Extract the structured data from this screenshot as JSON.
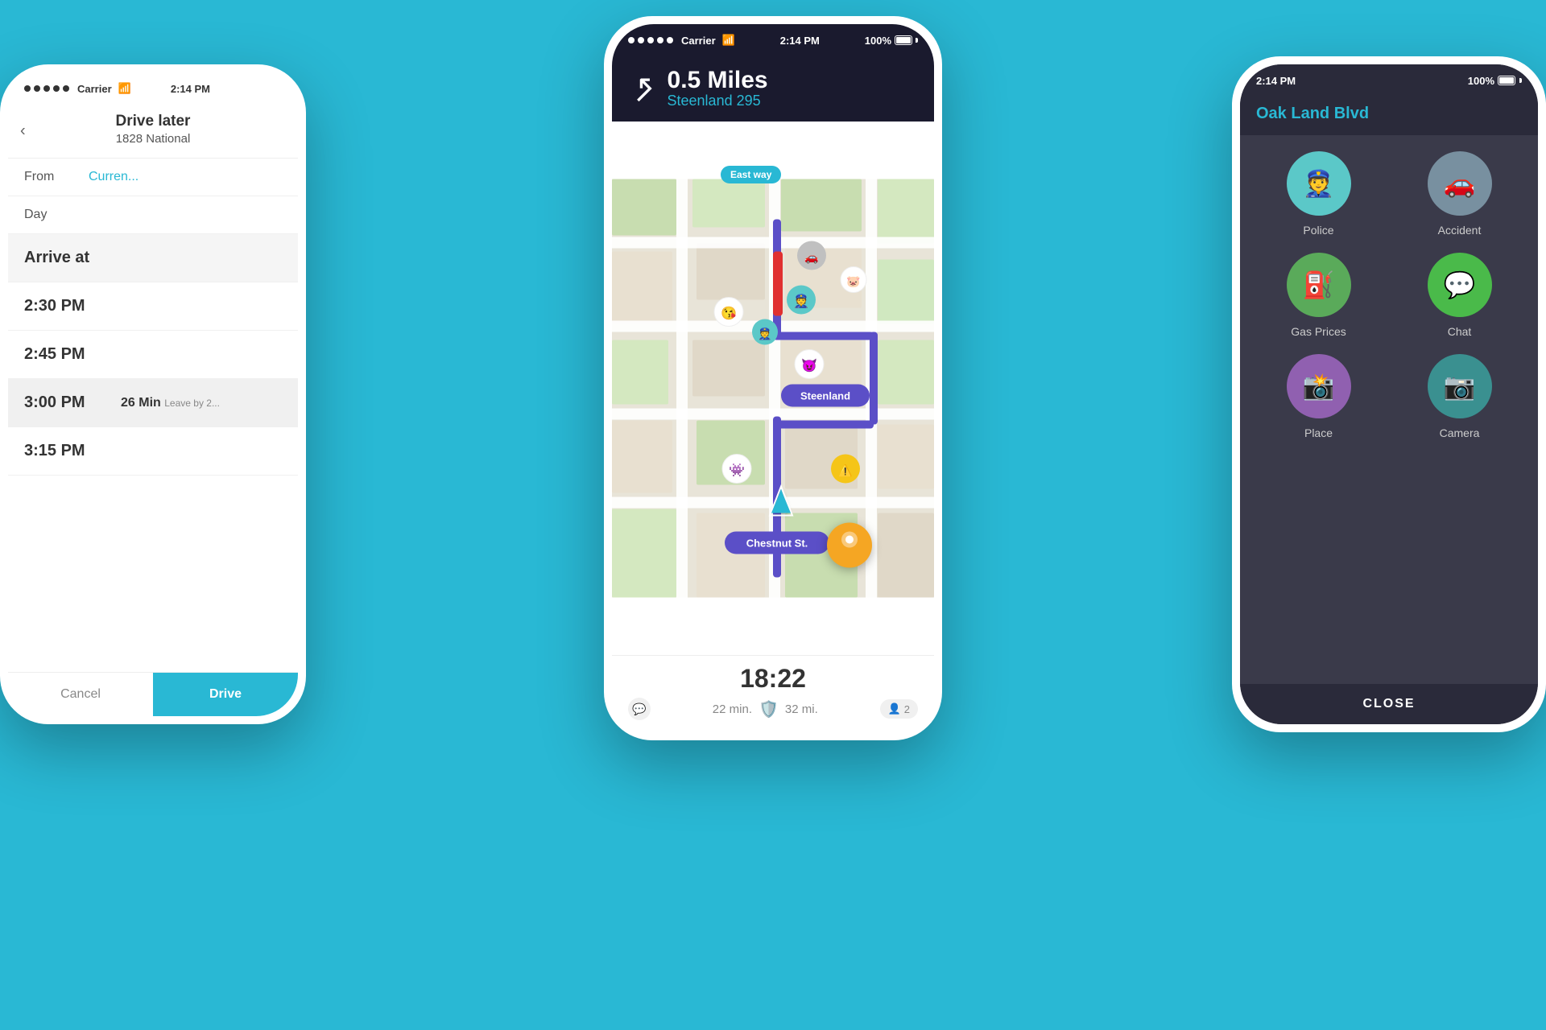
{
  "background_color": "#29b8d4",
  "phones": {
    "left": {
      "status_bar": {
        "carrier": "Carrier",
        "wifi": true,
        "time": "2:14 PM"
      },
      "header": {
        "back_label": "‹",
        "title": "Drive later",
        "subtitle": "1828 National"
      },
      "from_row": {
        "label": "From",
        "value": "Curren..."
      },
      "day_row": {
        "label": "Day"
      },
      "rows": [
        {
          "label": "Arrive at",
          "highlighted": true
        },
        {
          "label": "2:30 PM",
          "highlighted": false
        },
        {
          "label": "2:45 PM",
          "highlighted": false
        },
        {
          "label": "3:00 PM",
          "highlighted": true,
          "detail_title": "26 Min",
          "detail_sub": "Leave by 2..."
        },
        {
          "label": "3:15 PM",
          "highlighted": false
        }
      ],
      "cancel_label": "Cancel",
      "confirm_label": "Drive"
    },
    "center": {
      "status_bar": {
        "carrier": "Carrier",
        "wifi": true,
        "time": "2:14 PM",
        "battery": "100%"
      },
      "nav": {
        "distance": "0.5 Miles",
        "street": "Steenland 295"
      },
      "map": {
        "labels": [
          "East way",
          "Steenland",
          "Chestnut St."
        ]
      },
      "bottom": {
        "eta": "18:22",
        "minutes": "22 min.",
        "miles": "32 mi."
      }
    },
    "right": {
      "status_bar": {
        "time": "2:14 PM",
        "battery": "100%"
      },
      "street": "Oak Land Blvd",
      "menu_items": [
        {
          "label": "Police",
          "icon": "👮",
          "color": "teal"
        },
        {
          "label": "Accident",
          "icon": "🚗",
          "color": "blue-grey"
        },
        {
          "label": "Gas Prices",
          "icon": "⛽",
          "color": "green"
        },
        {
          "label": "Chat",
          "icon": "💬",
          "color": "green2"
        },
        {
          "label": "Place",
          "icon": "📸",
          "color": "purple"
        },
        {
          "label": "Camera",
          "icon": "📷",
          "color": "teal2"
        }
      ],
      "close_label": "CLOSE"
    }
  }
}
